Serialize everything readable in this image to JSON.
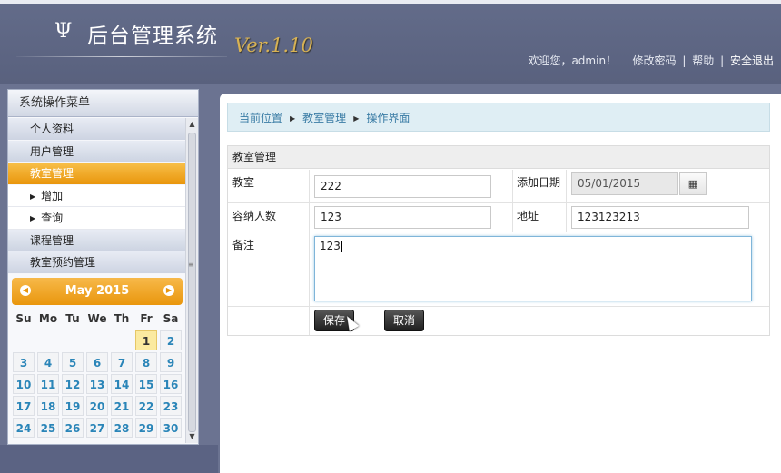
{
  "header": {
    "logo_glyph": "Ψ",
    "title": "后台管理系统",
    "version": "Ver.1.10",
    "welcome": "欢迎您，admin！",
    "change_password": "修改密码",
    "help": "帮助",
    "logout": "安全退出",
    "separator": "|"
  },
  "sidebar": {
    "title": "系统操作菜单",
    "items": [
      {
        "label": "个人资料"
      },
      {
        "label": "用户管理"
      },
      {
        "label": "教室管理",
        "active": true
      },
      {
        "label": "增加",
        "sub": true
      },
      {
        "label": "查询",
        "sub": true
      },
      {
        "label": "课程管理"
      },
      {
        "label": "教室预约管理"
      }
    ]
  },
  "calendar": {
    "month_label": "May 2015",
    "weekdays": [
      "Su",
      "Mo",
      "Tu",
      "We",
      "Th",
      "Fr",
      "Sa"
    ],
    "first_weekday_index": 5,
    "visible_days": 30,
    "today": 1
  },
  "breadcrumb": {
    "items": [
      "当前位置",
      "教室管理",
      "操作界面"
    ]
  },
  "form": {
    "title": "教室管理",
    "classroom_label": "教室",
    "classroom_value": "222",
    "date_label": "添加日期",
    "date_value": "05/01/2015",
    "capacity_label": "容纳人数",
    "capacity_value": "123",
    "address_label": "地址",
    "address_value": "123123213",
    "remark_label": "备注",
    "remark_value": "123",
    "save_label": "保存",
    "cancel_label": "取消"
  },
  "colors": {
    "header_bg": "#5f6785",
    "accent_orange": "#e9960c",
    "link_blue": "#3a7ca5",
    "version_gold": "#d8b254"
  },
  "icons": {
    "calendar_picker": "calendar-icon",
    "nav_prev": "chevron-left-icon",
    "nav_next": "chevron-right-icon"
  }
}
